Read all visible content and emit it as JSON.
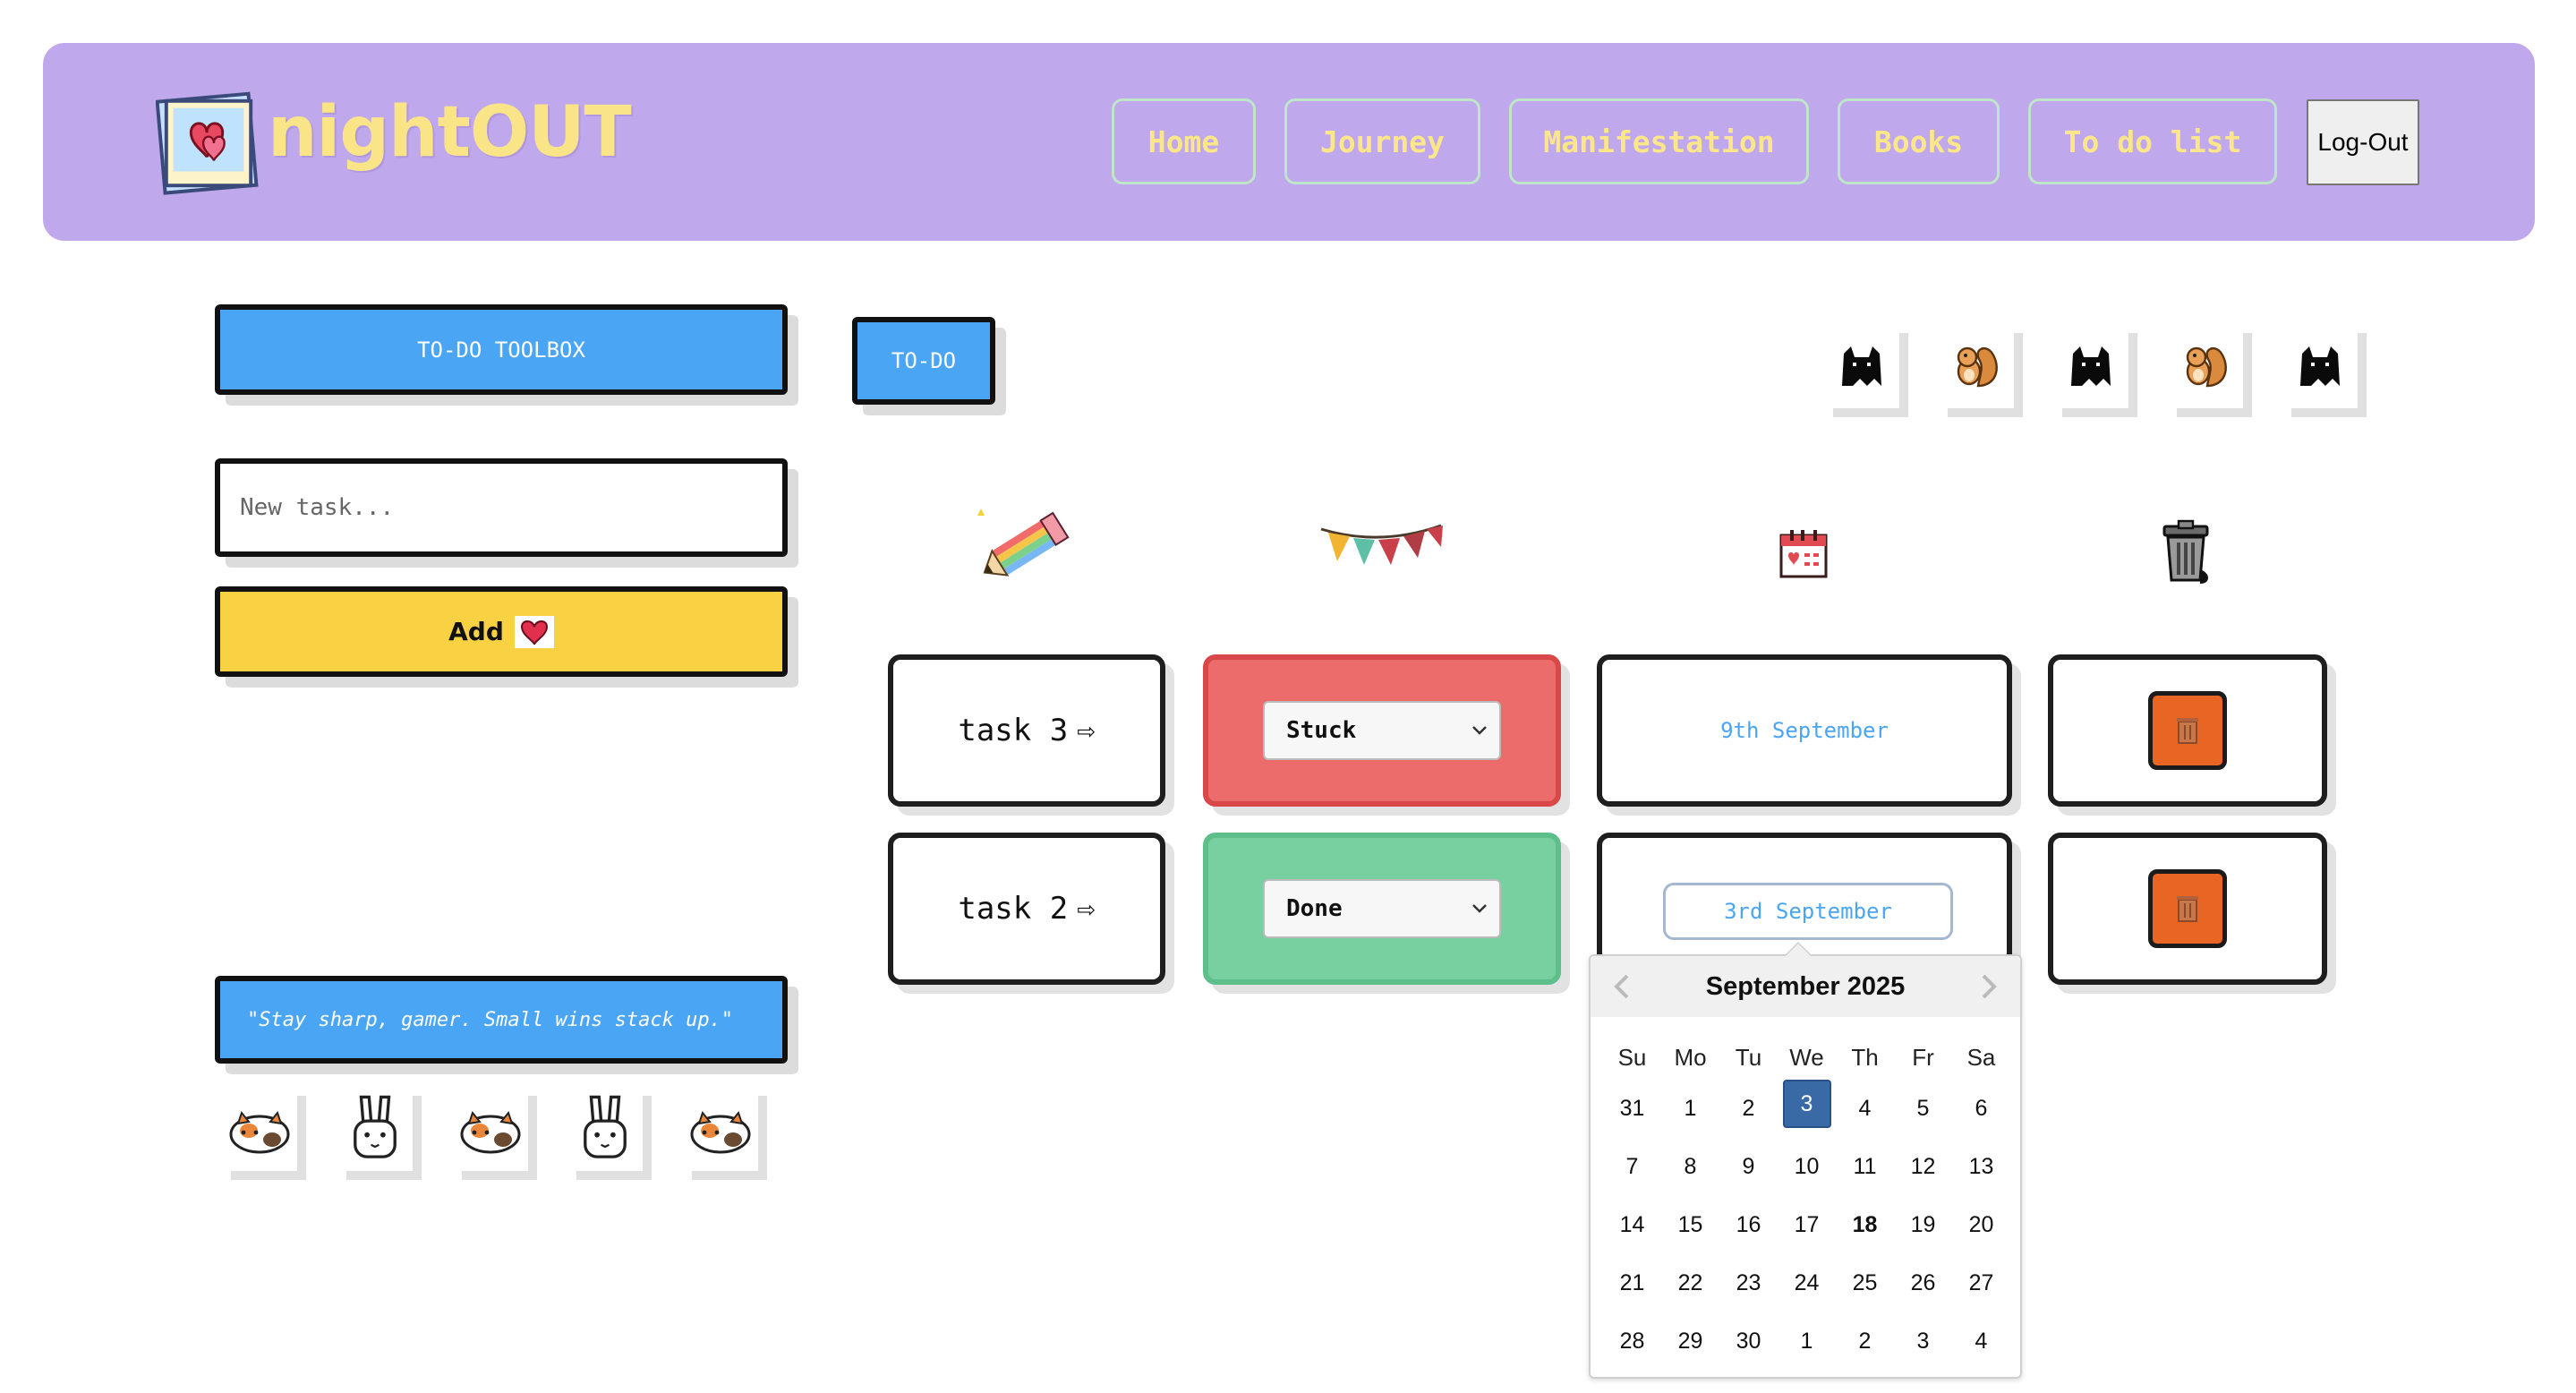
{
  "app": {
    "logo_text": "nightOUT"
  },
  "nav": {
    "items": [
      "Home",
      "Journey",
      "Manifestation",
      "Books",
      "To do list"
    ],
    "logout_label": "Log-Out"
  },
  "toolbox": {
    "title": "TO-DO TOOLBOX",
    "input_placeholder": "New task...",
    "input_value": "",
    "add_label": "Add",
    "quote": "\"Stay sharp, gamer. Small wins stack up.\""
  },
  "todo": {
    "tab_label": "TO-DO",
    "pets_top": [
      "black-cat-icon",
      "squirrel-icon",
      "black-cat-icon",
      "squirrel-icon",
      "black-cat-icon"
    ],
    "pets_bottom": [
      "calico-cat-icon",
      "bunny-icon",
      "calico-cat-icon",
      "bunny-icon",
      "calico-cat-icon"
    ],
    "column_icons": [
      "pencil-icon",
      "bunting-icon",
      "calendar-icon",
      "trash-can-icon"
    ],
    "tasks": [
      {
        "name": "task 3",
        "arrow": "⇨",
        "status": "Stuck",
        "status_color": "#ec6b6b",
        "date": "9th September"
      },
      {
        "name": "task 2",
        "arrow": "⇨",
        "status": "Done",
        "status_color": "#78cfa0",
        "date": "3rd September"
      }
    ]
  },
  "datepicker": {
    "month_label": "September 2025",
    "weekdays": [
      "Su",
      "Mo",
      "Tu",
      "We",
      "Th",
      "Fr",
      "Sa"
    ],
    "weeks": [
      [
        "31",
        "1",
        "2",
        "3",
        "4",
        "5",
        "6"
      ],
      [
        "7",
        "8",
        "9",
        "10",
        "11",
        "12",
        "13"
      ],
      [
        "14",
        "15",
        "16",
        "17",
        "18",
        "19",
        "20"
      ],
      [
        "21",
        "22",
        "23",
        "24",
        "25",
        "26",
        "27"
      ],
      [
        "28",
        "29",
        "30",
        "1",
        "2",
        "3",
        "4"
      ]
    ],
    "selected_day": "3",
    "today_day": "18"
  },
  "colors": {
    "header_bg": "#c0a8ec",
    "accent_blue": "#4aa6f4",
    "add_yellow": "#f8d243",
    "trash_orange": "#e96524"
  }
}
